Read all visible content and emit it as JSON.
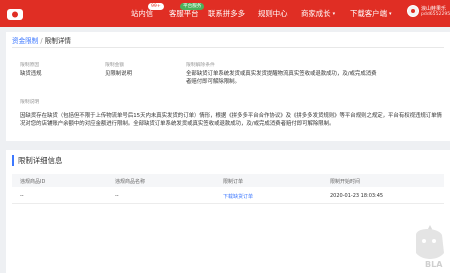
{
  "topbar": {
    "nav": [
      {
        "label": "站内信",
        "badge": "99+"
      },
      {
        "label": "客服平台",
        "badge": "平台服务"
      },
      {
        "label": "联系拼多多"
      },
      {
        "label": "规则中心"
      },
      {
        "label": "商家成长"
      },
      {
        "label": "下载客户端"
      }
    ],
    "user_name": "浪山鲑果乐",
    "user_id": "pdd65522950"
  },
  "breadcrumb": {
    "parent": "资金限制",
    "separator": "/",
    "current": "限制详情"
  },
  "detail": {
    "col1_label": "限制原因",
    "col1_value": "缺货违规",
    "col2_label": "限制金额",
    "col2_value": "见限制说明",
    "col3_label": "限制解除条件",
    "col3_value": "全部缺货订单系统发货或真实发货提醒物流真实签收或退款成功，及/或完成消费者赔付即可解除限制。",
    "desc_label": "限制说明",
    "desc_value": "因缺货存在缺货（包括但不限于上传物流单号后15天内未真实发货的订单）情形，根据《拼多多平台合作协议》及《拼多多发货规则》等平台规则之规定，平台有权视违规订单情况对您的店铺账户余额中的对应金额进行限制。全部缺货订单系统发货或真实签收或退款成功，及/或完成消费者赔付即可解除限制。"
  },
  "table": {
    "title": "限制详细信息",
    "headers": [
      "违规商品ID",
      "违规商品名称",
      "限制订单",
      "限制开始时间"
    ],
    "rows": [
      {
        "goods_id": "--",
        "goods_name": "--",
        "order": "下载缺货订单",
        "start_time": "2020-01-23 18:03:45"
      }
    ]
  },
  "watermark": {
    "text": "BLA"
  }
}
